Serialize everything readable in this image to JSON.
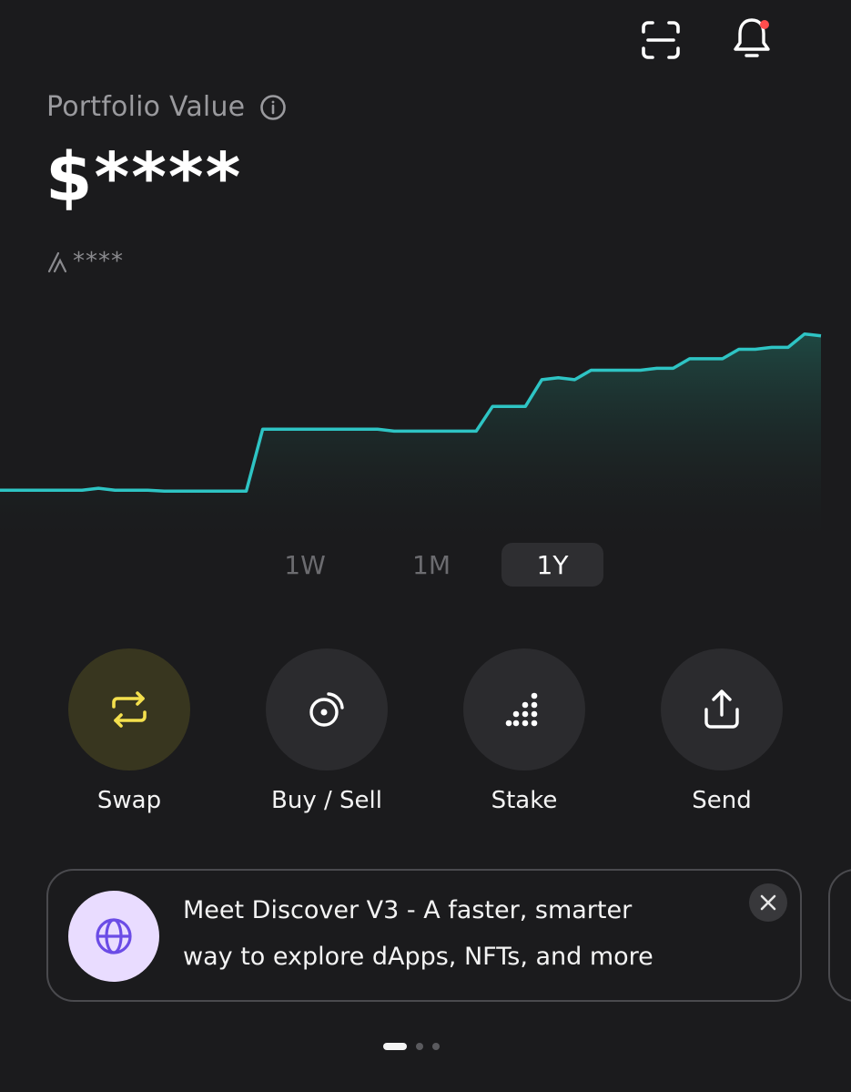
{
  "header": {
    "icons": [
      "scan-icon",
      "bell-icon"
    ],
    "has_notification": true
  },
  "portfolio": {
    "label": "Portfolio Value",
    "value": "$****",
    "change": "****"
  },
  "chart_data": {
    "type": "area",
    "title": "",
    "xlabel": "",
    "ylabel": "",
    "x": [
      0,
      1,
      2,
      3,
      4,
      5,
      6,
      7,
      8,
      9,
      10,
      11,
      12,
      13,
      14,
      15,
      16,
      17,
      18,
      19,
      20,
      21,
      22,
      23,
      24,
      25,
      26,
      27,
      28,
      29,
      30,
      31,
      32,
      33,
      34,
      35,
      36,
      37,
      38,
      39,
      40,
      41,
      42,
      43,
      44,
      45,
      46,
      47,
      48,
      49,
      50
    ],
    "values": [
      2.0,
      2.0,
      2.0,
      2.0,
      2.0,
      2.0,
      2.1,
      2.0,
      2.0,
      2.0,
      1.95,
      1.95,
      1.95,
      1.95,
      1.95,
      1.95,
      5.2,
      5.2,
      5.2,
      5.2,
      5.2,
      5.2,
      5.2,
      5.2,
      5.1,
      5.1,
      5.1,
      5.1,
      5.1,
      5.1,
      6.4,
      6.4,
      6.4,
      7.8,
      7.9,
      7.8,
      8.3,
      8.3,
      8.3,
      8.3,
      8.4,
      8.4,
      8.9,
      8.9,
      8.9,
      9.4,
      9.4,
      9.5,
      9.5,
      10.2,
      10.1
    ],
    "ylim": [
      0,
      11
    ],
    "grid": false,
    "legend": "none",
    "line_color": "#2ec4c4",
    "fill_color": "#1e3a36"
  },
  "tabs": [
    {
      "label": "1W",
      "active": false
    },
    {
      "label": "1M",
      "active": false
    },
    {
      "label": "1Y",
      "active": true
    }
  ],
  "actions": [
    {
      "label": "Swap",
      "icon": "swap-icon"
    },
    {
      "label": "Buy / Sell",
      "icon": "coins-icon"
    },
    {
      "label": "Stake",
      "icon": "stake-dots-icon"
    },
    {
      "label": "Send",
      "icon": "share-icon"
    }
  ],
  "banner": {
    "line1": "Meet Discover V3 - A faster, smarter",
    "line2": "way to explore dApps, NFTs, and more",
    "icon": "globe-icon"
  },
  "pagination": {
    "count": 3,
    "active": 0
  },
  "colors": {
    "background": "#1b1b1d",
    "accent_line": "#2ec4c4",
    "swap_accent": "#f4e04d",
    "notification": "#ff4d4d",
    "banner_icon_bg": "#e9dcff",
    "banner_icon": "#6b4ce6"
  }
}
